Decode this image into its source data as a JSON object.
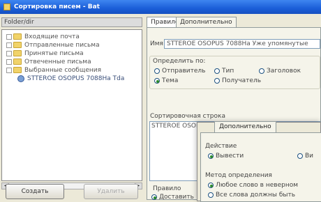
{
  "window": {
    "title": "Сортировка писем - Bat"
  },
  "left": {
    "header": "Folder/dir",
    "tree": [
      {
        "label": "Входящие почта",
        "kind": "folder"
      },
      {
        "label": "Отправленные письма",
        "kind": "folder"
      },
      {
        "label": "Принятые письма",
        "kind": "folder"
      },
      {
        "label": "Отвеченные письма",
        "kind": "folder"
      },
      {
        "label": "Выбранные сообщения",
        "kind": "folder"
      },
      {
        "label": "STTEROE OSOPUS 7088Ha Tda",
        "kind": "contact"
      }
    ],
    "new_button": "Создать",
    "delete_button": "Удалить"
  },
  "right": {
    "tabs": [
      "Правило",
      "Дополнительно"
    ],
    "name_label": "Имя",
    "name_value": "STTEROE OSOPUS 7088Ha Уже упомянутые",
    "group_label": "Определить по:",
    "radio_row1": [
      "Отправитель",
      "Тип",
      "Заголовок"
    ],
    "radio_row2": [
      "Тема",
      "Получатель"
    ],
    "search_label": "Сортировочная строка",
    "search_value": "STTEROE OSOPUS 7088Ha Уже упомянутые",
    "action_label": "Правило",
    "action_value": "Доставить"
  },
  "dialog": {
    "tab": "Дополнительно",
    "section1_label": "Действие",
    "opt_move": "Вывести",
    "opt_copy": "Ви",
    "section2_label": "Метод определения",
    "opt_method1": "Любое слово в неверном",
    "opt_method2": "Все слова должны быть"
  }
}
